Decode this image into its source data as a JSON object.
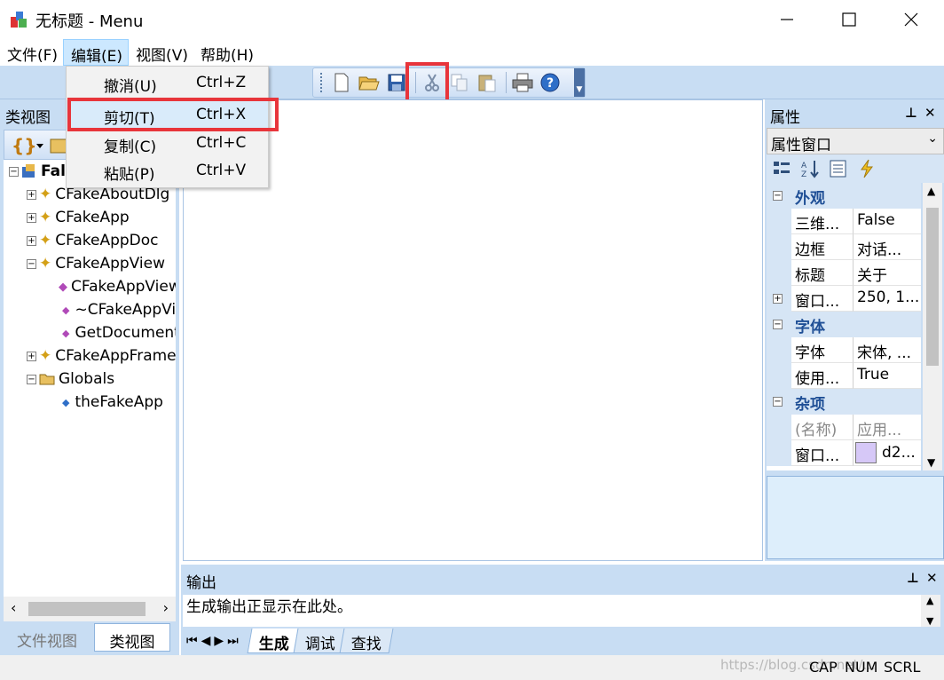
{
  "window": {
    "title": "无标题 - Menu",
    "minimize": "—",
    "maximize": "☐",
    "close": "✕"
  },
  "menubar": {
    "items": [
      {
        "label": "文件(F)"
      },
      {
        "label": "编辑(E)"
      },
      {
        "label": "视图(V)"
      },
      {
        "label": "帮助(H)"
      }
    ]
  },
  "edit_menu": {
    "items": [
      {
        "label": "撤消(U)",
        "shortcut": "Ctrl+Z"
      },
      {
        "label": "剪切(T)",
        "shortcut": "Ctrl+X"
      },
      {
        "label": "复制(C)",
        "shortcut": "Ctrl+C"
      },
      {
        "label": "粘贴(P)",
        "shortcut": "Ctrl+V"
      }
    ]
  },
  "toolbar": {
    "buttons": [
      {
        "icon": "new-file-icon"
      },
      {
        "icon": "open-folder-icon"
      },
      {
        "icon": "save-icon"
      },
      {
        "icon": "cut-icon"
      },
      {
        "icon": "copy-icon"
      },
      {
        "icon": "paste-icon"
      },
      {
        "icon": "print-icon"
      },
      {
        "icon": "help-icon"
      }
    ],
    "highlighted": "cut-icon",
    "highlight_color": "#e8353b"
  },
  "class_view": {
    "title": "类视图",
    "root_label": "Fal",
    "tree": [
      {
        "label": "CFakeAboutDlg"
      },
      {
        "label": "CFakeApp"
      },
      {
        "label": "CFakeAppDoc"
      },
      {
        "label": "CFakeAppView"
      },
      {
        "label": "CFakeAppView"
      },
      {
        "label": "~CFakeAppView"
      },
      {
        "label": "GetDocument"
      },
      {
        "label": "CFakeAppFrame"
      },
      {
        "label": "Globals"
      },
      {
        "label": "theFakeApp"
      }
    ],
    "tabs": [
      {
        "label": "文件视图"
      },
      {
        "label": "类视图"
      }
    ]
  },
  "properties": {
    "title": "属性",
    "combo_value": "属性窗口",
    "categories": [
      {
        "name": "外观",
        "rows": [
          {
            "name": "三维...",
            "value": "False"
          },
          {
            "name": "边框",
            "value": "对话..."
          },
          {
            "name": "标题",
            "value": "关于"
          },
          {
            "name": "窗口...",
            "value": "250, 1..."
          }
        ]
      },
      {
        "name": "字体",
        "rows": [
          {
            "name": "字体",
            "value": "宋体, ..."
          },
          {
            "name": "使用...",
            "value": "True"
          }
        ]
      },
      {
        "name": "杂项",
        "rows": [
          {
            "name": "(名称)",
            "value": "应用..."
          },
          {
            "name": "窗口...",
            "value": "d2..."
          }
        ]
      }
    ],
    "swatch_color": "#d6c8f7"
  },
  "output": {
    "title": "输出",
    "line1": "生成输出正显示在此处。",
    "tabs": [
      {
        "label": "生成"
      },
      {
        "label": "调试"
      },
      {
        "label": "查找"
      }
    ]
  },
  "statusbar": {
    "cap": "CAP",
    "num": "NUM",
    "scrl": "SCRL",
    "watermark": "https://blog.csdn.net/..."
  },
  "colors": {
    "accent": "#c8ddf3",
    "highlight_red": "#e8353b",
    "category_text": "#1f4f96"
  }
}
